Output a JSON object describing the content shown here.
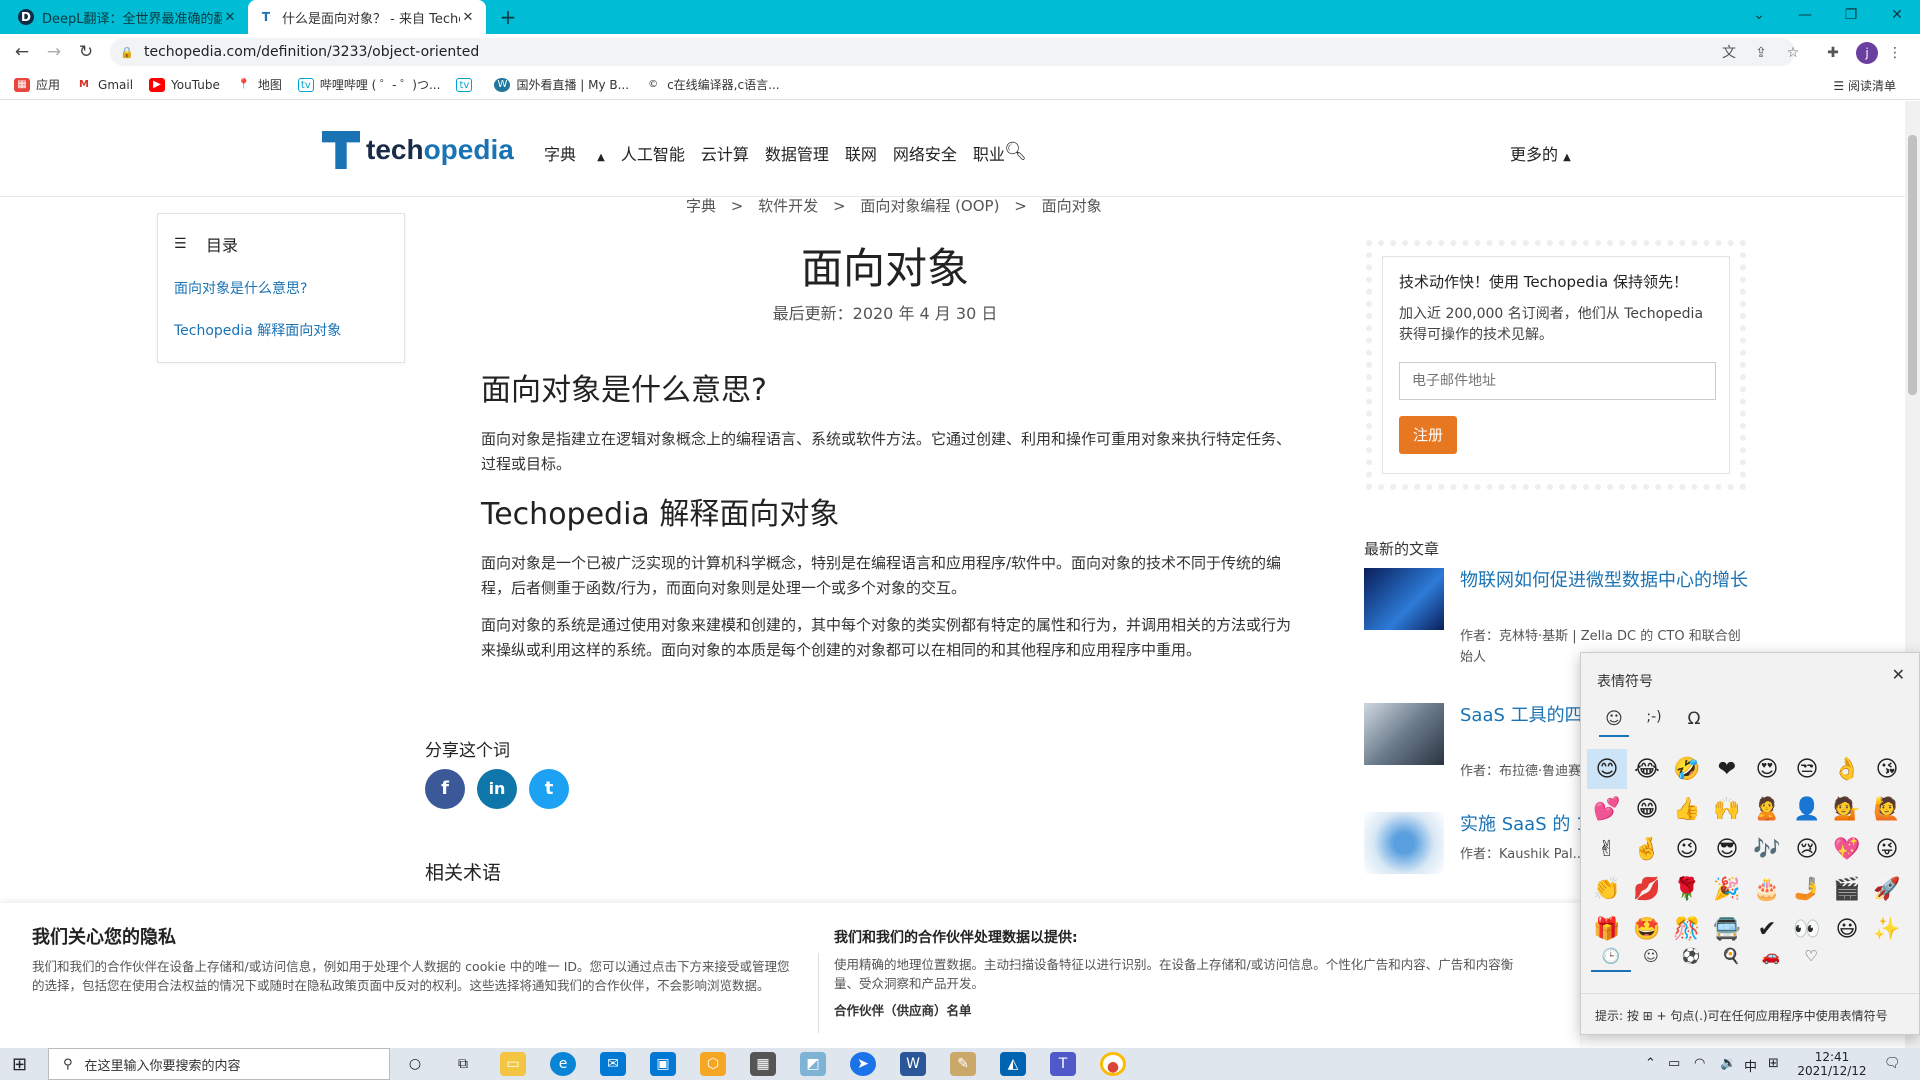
{
  "browser": {
    "tabs": [
      {
        "title": "DeepL翻译：全世界最准确的翻译",
        "icon": "deepl-icon"
      },
      {
        "title": "什么是面向对象？ - 来自 Techopedia 的定义",
        "icon": "techopedia-icon"
      }
    ],
    "new_tab": "+",
    "url": "techopedia.com/definition/3233/object-oriented",
    "profile_initial": "j",
    "bookmarks": [
      "应用",
      "Gmail",
      "YouTube",
      "地图",
      "哔哩哔哩 ( ゜- ゜)つ...",
      "",
      "国外看直播 | My B...",
      "c在线编译器,c语言..."
    ],
    "reading_list": "阅读清单"
  },
  "site": {
    "logo": {
      "part1": "tech",
      "part2": "opedia"
    },
    "nav": [
      "字典",
      "人工智能",
      "云计算",
      "数据管理",
      "联网",
      "网络安全",
      "职业"
    ],
    "more": "更多的"
  },
  "breadcrumb": [
    "字典",
    ">",
    "软件开发",
    ">",
    "面向对象编程 (OOP)",
    ">",
    "面向对象"
  ],
  "title": "面向对象",
  "updated": "最后更新：2020 年 4 月 30 日",
  "toc": {
    "heading": "目录",
    "items": [
      "面向对象是什么意思?",
      "Techopedia 解释面向对象"
    ]
  },
  "article": {
    "h1": "面向对象是什么意思?",
    "p1": "面向对象是指建立在逻辑对象概念上的编程语言、系统或软件方法。它通过创建、利用和操作可重用对象来执行特定任务、过程或目标。",
    "h2": "Techopedia 解释面向对象",
    "p2": "面向对象是一个已被广泛实现的计算机科学概念，特别是在编程语言和应用程序/软件中。面向对象的技术不同于传统的编程，后者侧重于函数/行为，而面向对象则是处理一个或多个对象的交互。",
    "p3": "面向对象的系统是通过使用对象来建模和创建的，其中每个对象的类实例都有特定的属性和行为，并调用相关的方法或行为来操纵或利用这样的系统。面向对象的本质是每个创建的对象都可以在相同的和其他程序和应用程序中重用。"
  },
  "share": {
    "label": "分享这个词",
    "icons": [
      "f",
      "in",
      "t"
    ]
  },
  "related": "相关术语",
  "newsletter": {
    "title": "技术动作快！使用 Techopedia 保持领先！",
    "text": "加入近 200,000 名订阅者，他们从 Techopedia 获得可操作的技术见解。",
    "placeholder": "电子邮件地址",
    "button": "注册"
  },
  "latest": {
    "heading": "最新的文章",
    "articles": [
      {
        "title": "物联网如何促进微型数据中心的增长",
        "byline": "作者：克林特·基斯 | Zella DC 的 CTO 和联合创始人"
      },
      {
        "title": "SaaS 工具的四...使用它们",
        "byline": "作者：布拉德·鲁迪赛..."
      },
      {
        "title": "实施 SaaS 的 1...",
        "byline": "作者：Kaushik Pal..."
      }
    ]
  },
  "privacy": {
    "heading": "我们关心您的隐私",
    "text": "我们和我们的合作伙伴在设备上存储和/或访问信息，例如用于处理个人数据的 cookie 中的唯一 ID。您可以通过点击下方来接受或管理您的选择，包括您在使用合法权益的情况下或随时在隐私政策页面中反对的权利。这些选择将通知我们的合作伙伴，不会影响浏览数据。",
    "heading2": "我们和我们的合作伙伴处理数据以提供:",
    "text2": "使用精确的地理位置数据。主动扫描设备特征以进行识别。在设备上存储和/或访问信息。个性化广告和内容、广告和内容衡量、受众洞察和产品开发。",
    "vendors": "合作伙伴（供应商）名单"
  },
  "emoji_panel": {
    "title": "表情符号",
    "tabs": [
      "☺",
      ";-)",
      "Ω"
    ],
    "emojis": [
      "😊",
      "😂",
      "🤣",
      "❤",
      "😍",
      "😒",
      "👌",
      "😘",
      "💕",
      "😁",
      "👍",
      "🙌",
      "🙎",
      "👤",
      "💁",
      "🙋",
      "✌",
      "🤞",
      "😉",
      "😎",
      "🎶",
      "😢",
      "💖",
      "😜",
      "👏",
      "💋",
      "🌹",
      "🎉",
      "🎂",
      "🤳",
      "🎬",
      "🚀",
      "🎁",
      "🤩",
      "🎊",
      "🚍",
      "✔",
      "👀",
      "😃",
      "✨"
    ],
    "categories": [
      "🕒",
      "☺",
      "⚽",
      "🍳",
      "🚗",
      "♡"
    ],
    "hint": "提示: 按 ⊞ + 句点(.)可在任何应用程序中使用表情符号"
  },
  "taskbar": {
    "search_placeholder": "在这里输入你要搜索的内容",
    "ime": "中",
    "time": "12:41",
    "date": "2021/12/12"
  }
}
